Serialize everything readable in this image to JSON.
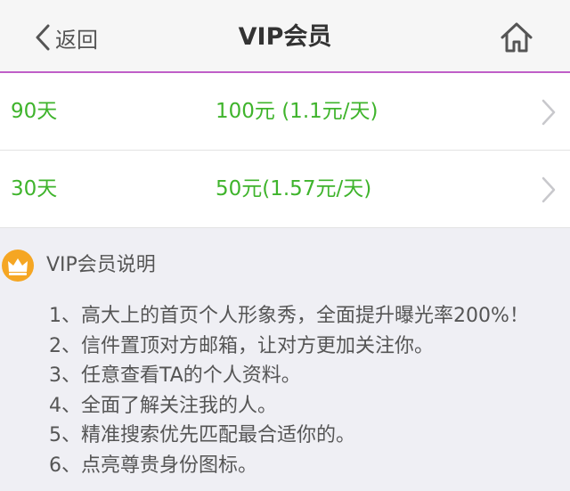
{
  "header": {
    "back_label": "返回",
    "title": "VIP会员"
  },
  "plans": [
    {
      "duration": "90天",
      "price": "100元 (1.1元/天)"
    },
    {
      "duration": "30天",
      "price": "50元(1.57元/天)"
    }
  ],
  "info": {
    "title": "VIP会员说明",
    "rules": [
      "1、高大上的首页个人形象秀，全面提升曝光率200%！",
      "2、信件置顶对方邮箱，让对方更加关注你。",
      "3、任意查看TA的个人资料。",
      "4、全面了解关注我的人。",
      "5、精准搜索优先匹配最合适你的。",
      "6、点亮尊贵身份图标。"
    ]
  },
  "colors": {
    "accent_green": "#3fb42c",
    "header_border": "#c05fc8",
    "crown_badge": "#f5a623"
  },
  "icons": {
    "back": "chevron-left-icon",
    "home": "home-icon",
    "row_arrow": "chevron-right-icon",
    "badge": "crown-icon"
  }
}
